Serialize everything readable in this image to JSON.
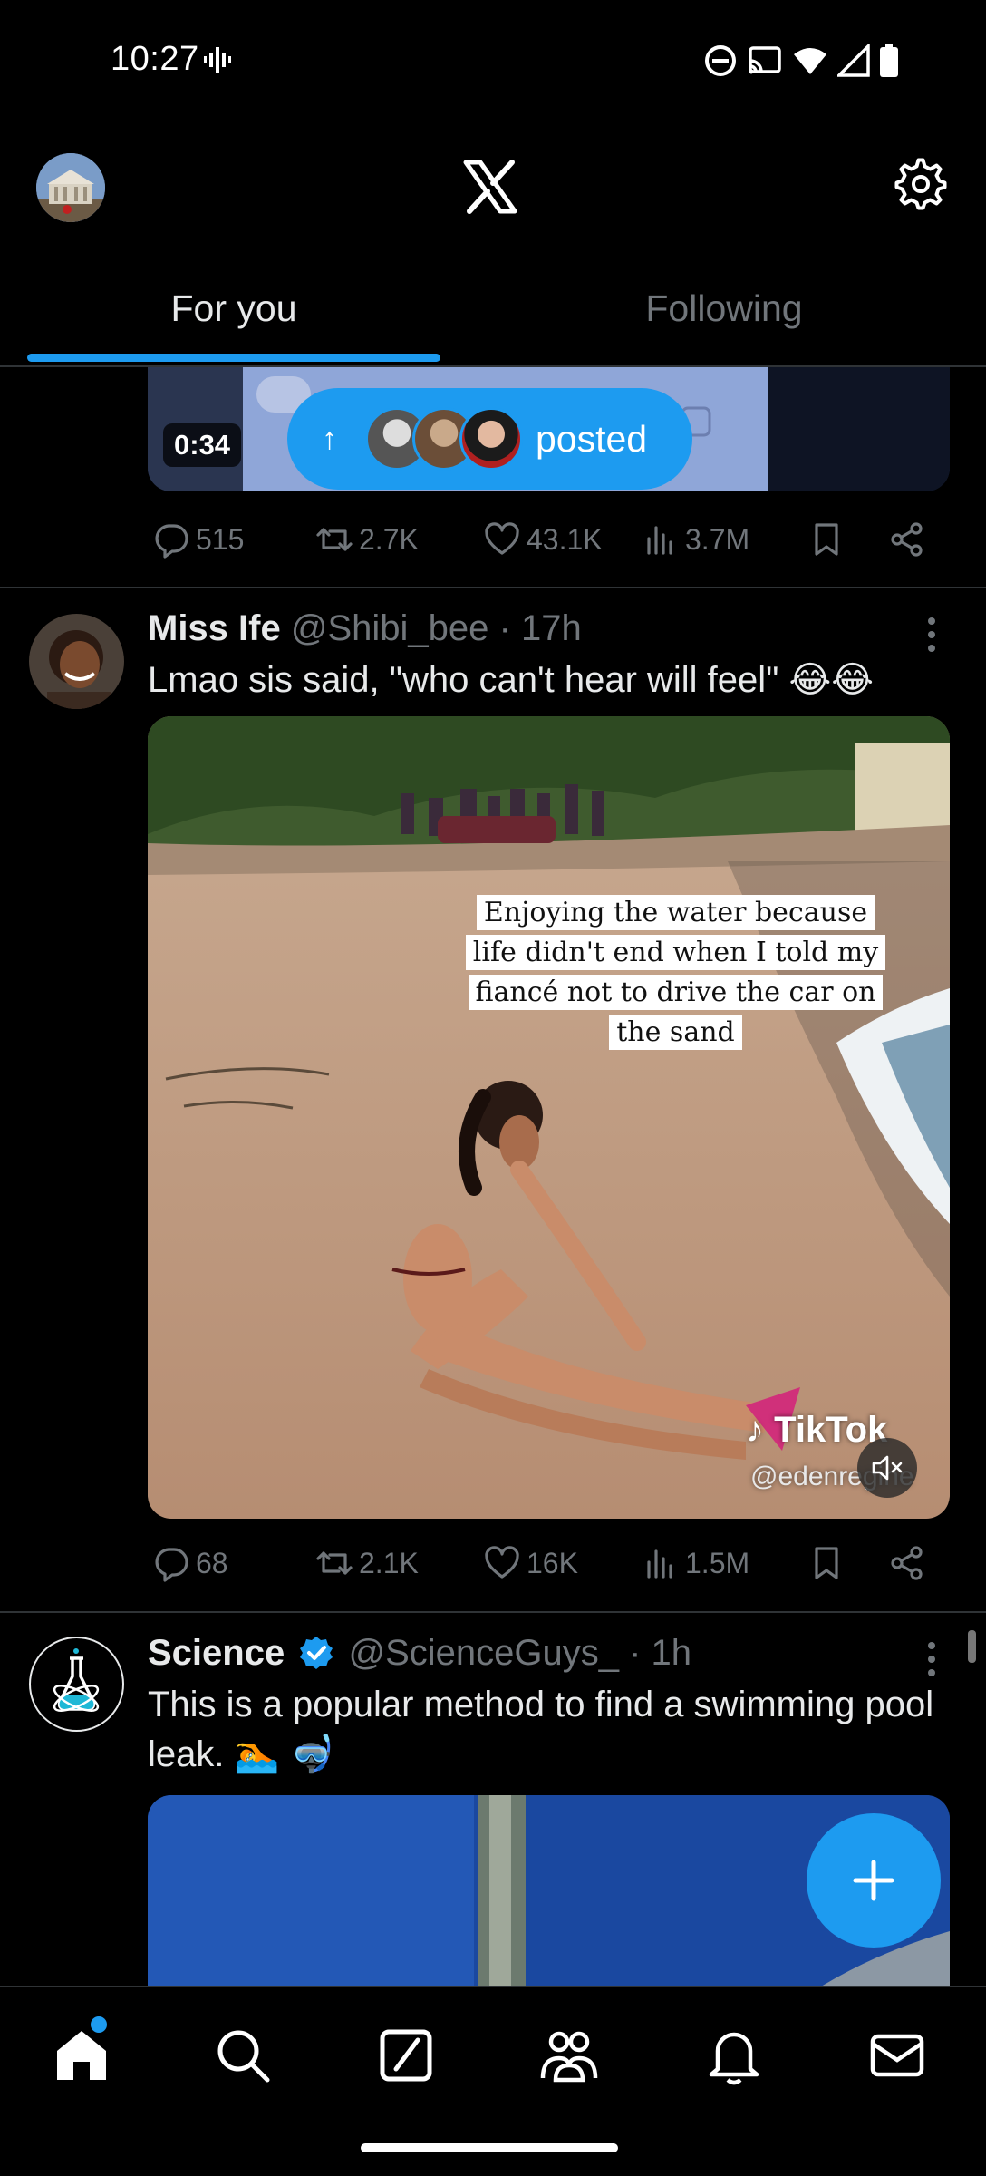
{
  "status_bar": {
    "time": "10:27"
  },
  "header": {
    "tabs": [
      {
        "label": "For you",
        "active": true
      },
      {
        "label": "Following",
        "active": false
      }
    ]
  },
  "top_post": {
    "video_duration": "0:34",
    "posted_pill_label": "posted",
    "stats": {
      "replies": "515",
      "reposts": "2.7K",
      "likes": "43.1K",
      "views": "3.7M"
    }
  },
  "post1": {
    "name": "Miss Ife",
    "handle": "@Shibi_bee",
    "time": "· 17h",
    "text": "Lmao sis said, \"who can't hear will feel\" 😂😂",
    "caption_lines": [
      "Enjoying  the water because",
      "life didn't end when I told my",
      "fiancé not to drive the car on",
      "the sand"
    ],
    "watermark": "TikTok",
    "watermark_user": "@edenregine",
    "stats": {
      "replies": "68",
      "reposts": "2.1K",
      "likes": "16K",
      "views": "1.5M"
    }
  },
  "post2": {
    "name": "Science",
    "handle": "@ScienceGuys_",
    "time": "· 1h",
    "text": "This is a popular method to find a swimming pool leak. 🏊 🤿"
  },
  "colors": {
    "accent": "#1d9bf0",
    "muted": "#71767b",
    "text": "#e7e9ea",
    "background": "#000000",
    "divider": "#2f3336"
  },
  "icons": {
    "status": [
      "vibrate-icon",
      "dnd-icon",
      "cast-icon",
      "wifi-icon",
      "signal-icon",
      "battery-icon"
    ],
    "nav": [
      "home-icon",
      "search-icon",
      "grok-icon",
      "communities-icon",
      "notifications-icon",
      "messages-icon"
    ]
  }
}
